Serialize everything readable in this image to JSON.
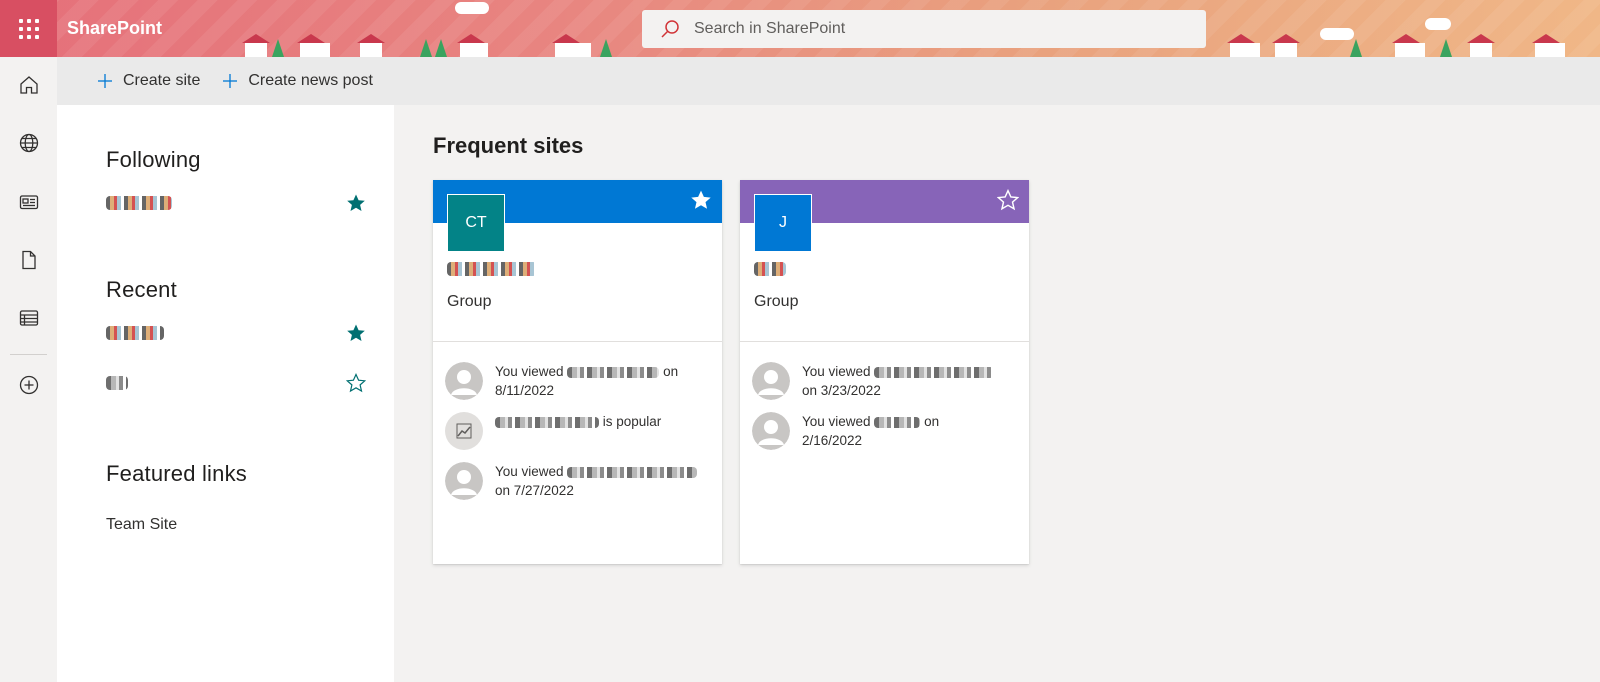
{
  "suitebar": {
    "app_name": "SharePoint",
    "search_placeholder": "Search in SharePoint",
    "bg_color": "#e5707a"
  },
  "rail": {
    "items": [
      {
        "name": "home",
        "icon": "home-icon"
      },
      {
        "name": "sites",
        "icon": "globe-icon"
      },
      {
        "name": "news",
        "icon": "news-icon"
      },
      {
        "name": "files",
        "icon": "document-icon"
      },
      {
        "name": "lists",
        "icon": "list-icon"
      },
      {
        "name": "create",
        "icon": "add-circle-icon"
      }
    ]
  },
  "commandbar": {
    "create_site": "Create site",
    "create_news_post": "Create news post"
  },
  "left_panel": {
    "following_title": "Following",
    "recent_title": "Recent",
    "featured_title": "Featured links",
    "following": [
      {
        "starred": true
      }
    ],
    "recent": [
      {
        "starred": true
      },
      {
        "starred": false
      }
    ],
    "featured_links": [
      "Team Site"
    ]
  },
  "main": {
    "title": "Frequent sites",
    "cards": [
      {
        "initials": "CT",
        "type": "Group",
        "header_color": "#0078d4",
        "logo_color": "#038387",
        "starred": true,
        "activities": [
          {
            "kind": "viewed",
            "prefix": "You viewed",
            "suffix": "on",
            "date": "8/11/2022"
          },
          {
            "kind": "popular",
            "suffix": "is popular"
          },
          {
            "kind": "viewed",
            "prefix": "You viewed",
            "suffix": "",
            "date": "on 7/27/2022"
          }
        ]
      },
      {
        "initials": "J",
        "type": "Group",
        "header_color": "#8764b8",
        "logo_color": "#0078d4",
        "starred": false,
        "activities": [
          {
            "kind": "viewed",
            "prefix": "You viewed",
            "suffix": "",
            "date": "on 3/23/2022"
          },
          {
            "kind": "viewed",
            "prefix": "You viewed",
            "suffix": "on",
            "date": "2/16/2022"
          }
        ]
      }
    ]
  }
}
